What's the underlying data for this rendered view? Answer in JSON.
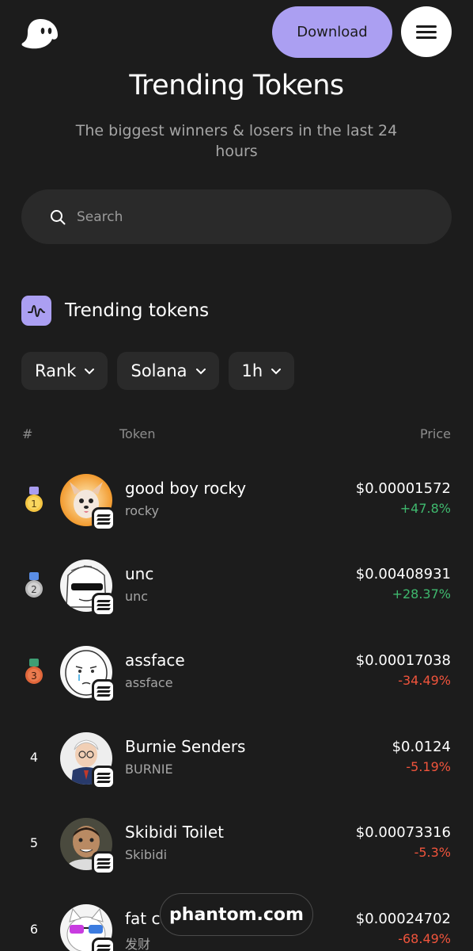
{
  "header": {
    "download_label": "Download"
  },
  "page": {
    "title": "Trending Tokens",
    "subtitle": "The biggest winners & losers in the last 24 hours"
  },
  "search": {
    "placeholder": "Search"
  },
  "section": {
    "title": "Trending tokens"
  },
  "filters": {
    "sort": "Rank",
    "chain": "Solana",
    "timeframe": "1h"
  },
  "table": {
    "col_rank": "#",
    "col_token": "Token",
    "col_price": "Price"
  },
  "tokens": [
    {
      "rank": "1",
      "name": "good boy rocky",
      "symbol": "rocky",
      "price": "$0.00001572",
      "change": "+47.8%",
      "direction": "up"
    },
    {
      "rank": "2",
      "name": "unc",
      "symbol": "unc",
      "price": "$0.00408931",
      "change": "+28.37%",
      "direction": "up"
    },
    {
      "rank": "3",
      "name": "assface",
      "symbol": "assface",
      "price": "$0.00017038",
      "change": "-34.49%",
      "direction": "down"
    },
    {
      "rank": "4",
      "name": "Burnie Senders",
      "symbol": "BURNIE",
      "price": "$0.0124",
      "change": "-5.19%",
      "direction": "down"
    },
    {
      "rank": "5",
      "name": "Skibidi Toilet",
      "symbol": "Skibidi",
      "price": "$0.00073316",
      "change": "-5.3%",
      "direction": "down"
    },
    {
      "rank": "6",
      "name": "fat cat",
      "symbol": "发财",
      "price": "$0.00024702",
      "change": "-68.49%",
      "direction": "down"
    }
  ],
  "watermark": "phantom.com",
  "colors": {
    "accent": "#ab9ff2",
    "background": "#1c1c1c",
    "positive": "#3fb96e",
    "negative": "#f0543c"
  }
}
